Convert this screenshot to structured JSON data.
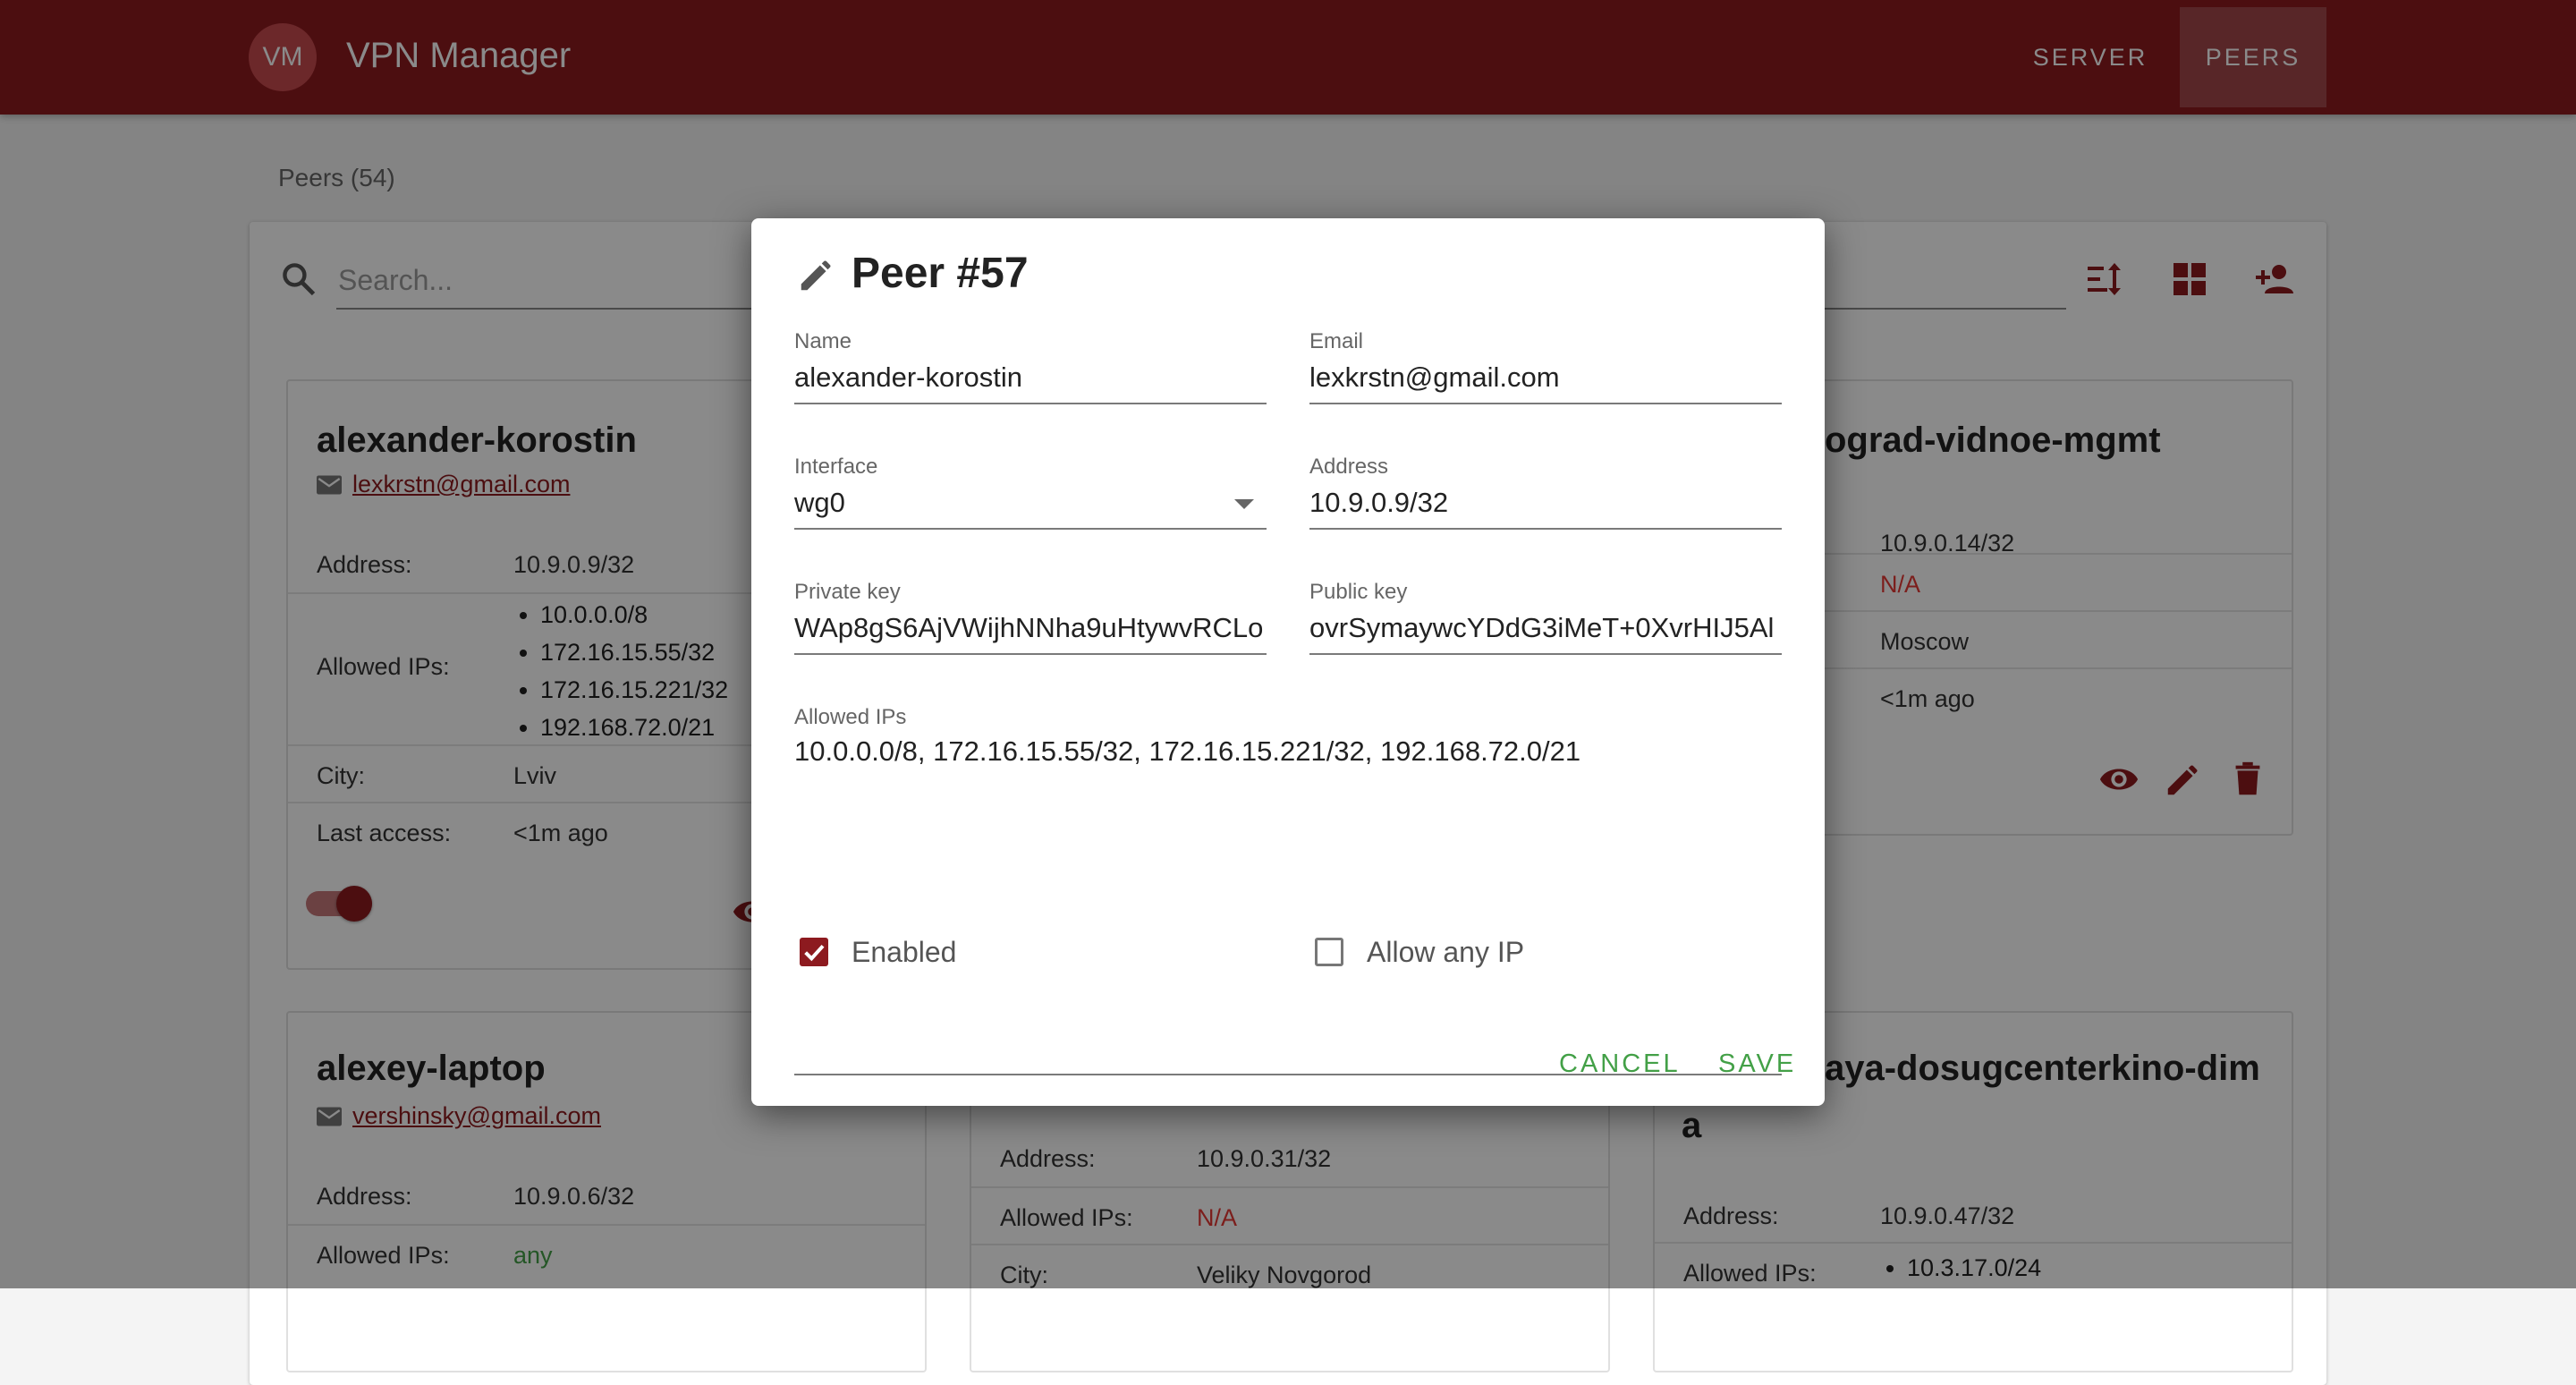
{
  "header": {
    "avatar_initials": "VM",
    "app_title": "VPN Manager",
    "nav": {
      "server": "SERVER",
      "peers": "PEERS"
    }
  },
  "page": {
    "peers_count_label": "Peers (54)",
    "search_placeholder": "Search..."
  },
  "cards": [
    {
      "name": "alexander-korostin",
      "email": "lexkrstn@gmail.com",
      "address_label": "Address:",
      "address": "10.9.0.9/32",
      "allowed_label": "Allowed IPs:",
      "allowed_ips": [
        "10.0.0.0/8",
        "172.16.15.55/32",
        "172.16.15.221/32",
        "192.168.72.0/21"
      ],
      "city_label": "City:",
      "city": "Lviv",
      "access_label": "Last access:",
      "last_access": "<1m ago",
      "enabled": true
    },
    {
      "name_fragment": "ograd-vidnoe-mgmt",
      "address": "10.9.0.14/32",
      "allowed": "N/A",
      "city": "Moscow",
      "last_access": "<1m ago"
    },
    {
      "name": "alexey-laptop",
      "email": "vershinsky@gmail.com",
      "address_label": "Address:",
      "address": "10.9.0.6/32",
      "allowed_label": "Allowed IPs:",
      "allowed": "any"
    },
    {
      "address_label": "Address:",
      "address": "10.9.0.31/32",
      "allowed_label": "Allowed IPs:",
      "allowed": "N/A",
      "city_label": "City:",
      "city": "Veliky Novgorod"
    },
    {
      "name_fragment_1": "aya-dosugcenterkino-dim",
      "name_fragment_2": "a",
      "address_label": "Address:",
      "address": "10.9.0.47/32",
      "allowed_label": "Allowed IPs:",
      "allowed_ips": [
        "10.3.17.0/24"
      ]
    }
  ],
  "dialog": {
    "title": "Peer #57",
    "name_label": "Name",
    "name": "alexander-korostin",
    "email_label": "Email",
    "email": "lexkrstn@gmail.com",
    "interface_label": "Interface",
    "interface": "wg0",
    "address_label": "Address",
    "address": "10.9.0.9/32",
    "private_key_label": "Private key",
    "private_key": "WAp8gS6AjVWijhNNha9uHtywvRCLo",
    "public_key_label": "Public key",
    "public_key": "ovrSymaywcYDdG3iMeT+0XvrHIJ5Al",
    "allowed_ips_label": "Allowed IPs",
    "allowed_ips": "10.0.0.0/8, 172.16.15.55/32, 172.16.15.221/32, 192.168.72.0/21",
    "enabled_label": "Enabled",
    "enabled": true,
    "allow_any_label": "Allow any IP",
    "allow_any": false,
    "cancel": "CANCEL",
    "save": "SAVE"
  },
  "colors": {
    "primary": "#8d1a1f",
    "action_green": "#43a047",
    "na_red": "#e53935"
  },
  "icons": [
    "search-icon",
    "sort-icon",
    "grid-view-icon",
    "add-person-icon",
    "email-icon",
    "eye-icon",
    "edit-icon",
    "trash-icon",
    "dropdown-caret-icon",
    "checkbox-icon"
  ]
}
